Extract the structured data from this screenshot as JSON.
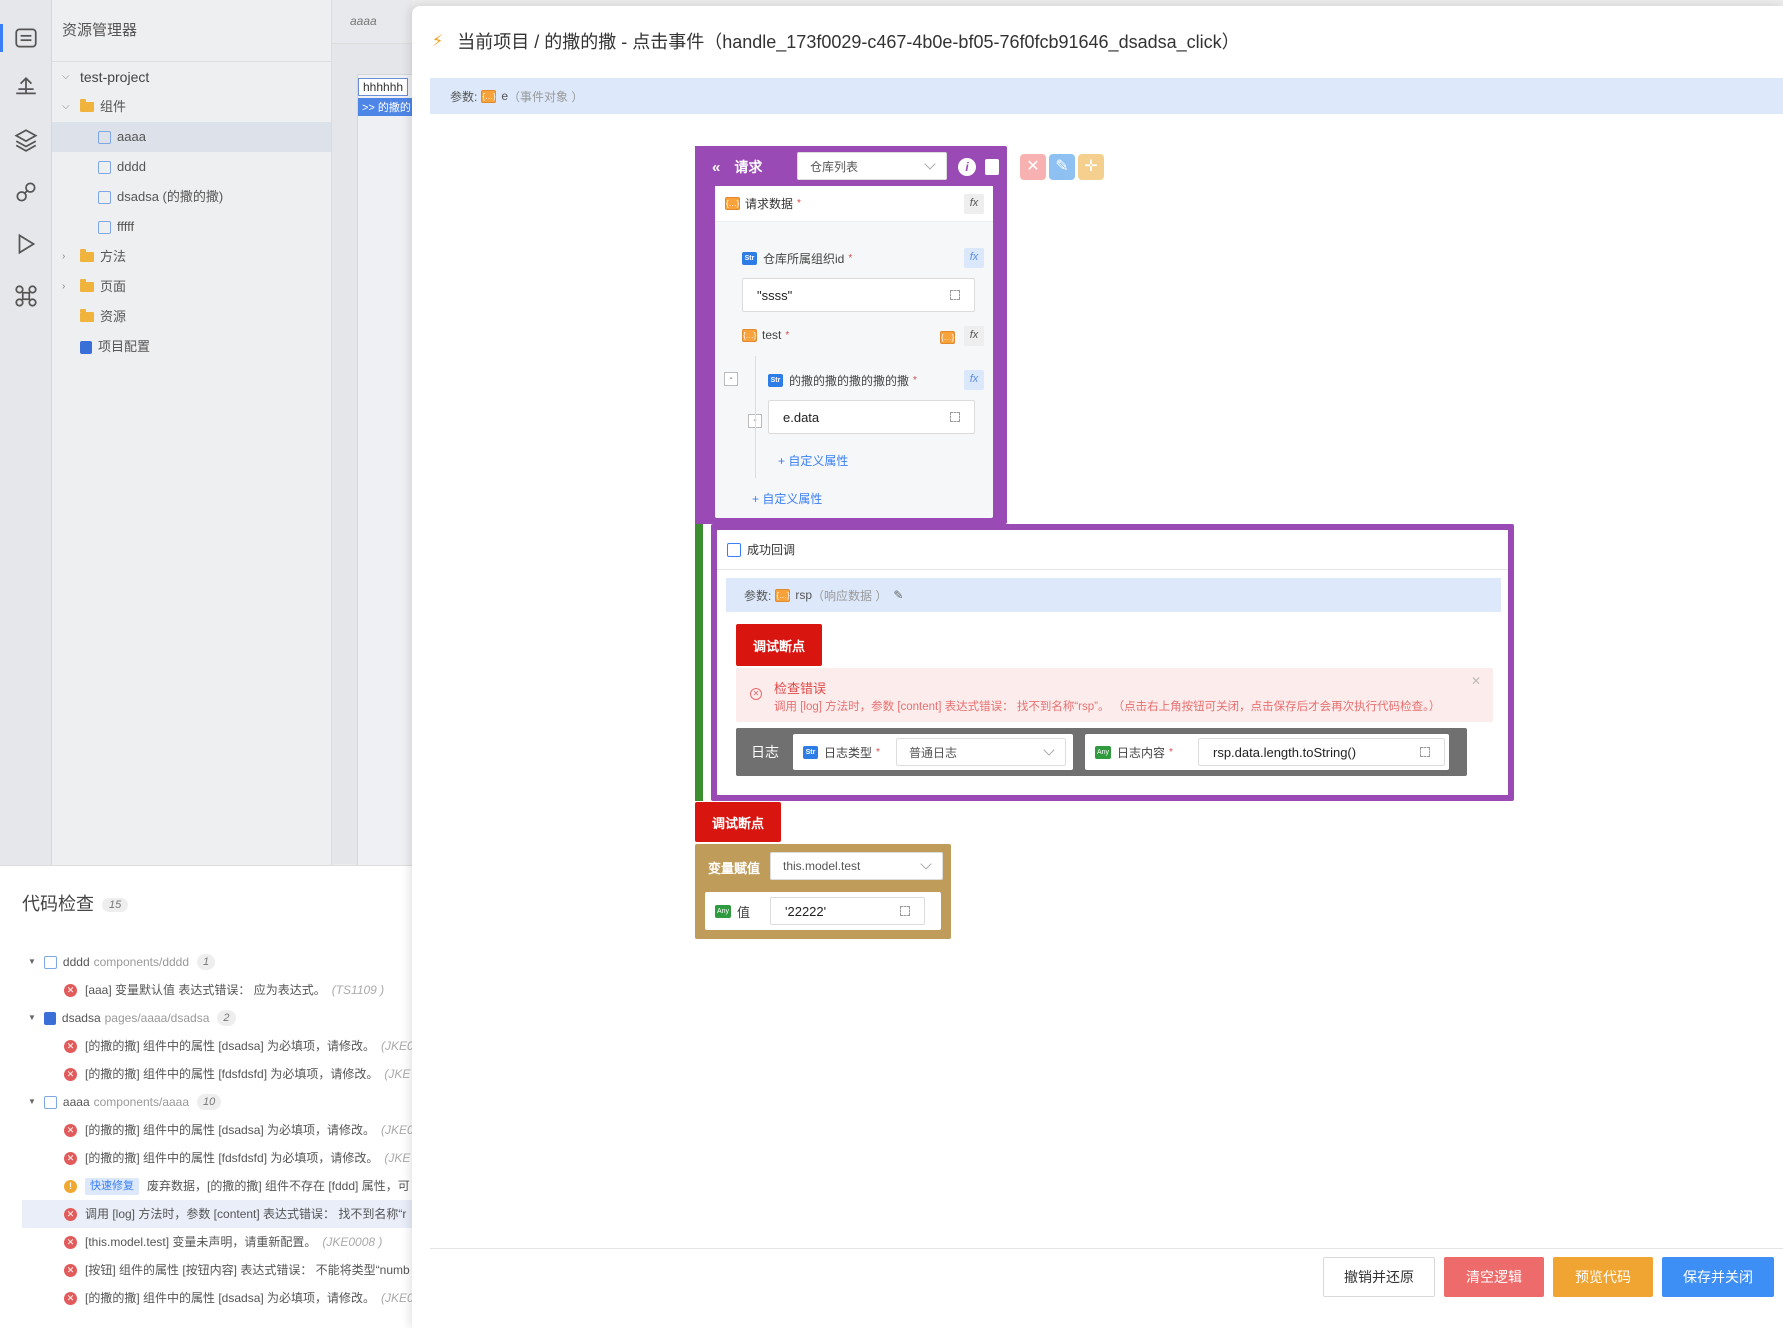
{
  "explorer": {
    "title": "资源管理器",
    "project": "test-project",
    "nodes": {
      "components": "组件",
      "aaaa": "aaaa",
      "dddd": "dddd",
      "dsadsa": "dsadsa (的撒的撒)",
      "fffff": "fffff",
      "methods": "方法",
      "pages": "页面",
      "resources": "资源",
      "project_config": "项目配置"
    }
  },
  "editor": {
    "tab": "aaaa",
    "canvas_text_1": "hhhhhh",
    "canvas_text_2": ">> 的撒的"
  },
  "check": {
    "title": "代码检查",
    "count": "15",
    "groups": [
      {
        "name": "dddd",
        "path": "components/dddd",
        "count": "1"
      },
      {
        "name": "dsadsa",
        "path": "pages/aaaa/dsadsa",
        "count": "2"
      },
      {
        "name": "aaaa",
        "path": "components/aaaa",
        "count": "10"
      }
    ],
    "items": [
      {
        "msg": "[aaa] 变量默认值 表达式错误： 应为表达式。",
        "code": "(TS1109 )"
      },
      {
        "msg": "[的撒的撒] 组件中的属性 [dsadsa] 为必填项，请修改。",
        "code": "(JKE0"
      },
      {
        "msg": "[的撒的撒] 组件中的属性 [fdsfdsfd] 为必填项，请修改。",
        "code": "(JKE"
      },
      {
        "msg": "[的撒的撒] 组件中的属性 [dsadsa] 为必填项，请修改。",
        "code": "(JKE0"
      },
      {
        "msg": "[的撒的撒] 组件中的属性 [fdsfdsfd] 为必填项，请修改。",
        "code": "(JKE"
      },
      {
        "quickfix": "快速修复",
        "msg": "废弃数据，[的撒的撒] 组件不存在 [fddd] 属性，可"
      },
      {
        "msg": "调用 [log] 方法时，参数 [content] 表达式错误： 找不到名称“r"
      },
      {
        "msg": "[this.model.test] 变量未声明，请重新配置。",
        "code": "(JKE0008 )"
      },
      {
        "msg": "[按钮] 组件的属性 [按钮内容] 表达式错误： 不能将类型“numb"
      },
      {
        "msg": "[的撒的撒] 组件中的属性 [dsadsa] 为必填项，请修改。",
        "code": "(JKE0"
      }
    ]
  },
  "modal": {
    "title": "当前项目 / 的撒的撒 - 点击事件（handle_173f0029-c467-4b0e-bf05-76f0fcb91646_dsadsa_click）",
    "param_label": "参数:",
    "param_name": "e",
    "param_desc": "（事件对象 ）",
    "request": {
      "label": "请求",
      "select": "仓库列表",
      "data_label": "请求数据",
      "field1_label": "仓库所属组织id",
      "field1_value": "\"ssss\"",
      "test_label": "test",
      "nested_label": "的撒的撒的撒的撒的撒",
      "nested_value": "e.data",
      "add_prop_inner": "+ 自定义属性",
      "add_prop_outer": "+ 自定义属性"
    },
    "callback": {
      "title": "成功回调",
      "param_label": "参数:",
      "param_name": "rsp",
      "param_desc": "（响应数据 ）",
      "debug": "调试断点",
      "err_title": "检查错误",
      "err_msg": "调用 [log] 方法时，参数 [content] 表达式错误： 找不到名称“rsp”。 （点击右上角按钮可关闭，点击保存后才会再次执行代码检查。）",
      "log_label": "日志",
      "log_type_label": "日志类型",
      "log_type_value": "普通日志",
      "log_content_label": "日志内容",
      "log_content_value": "rsp.data.length.toString()"
    },
    "debug_outer": "调试断点",
    "var": {
      "label": "变量赋值",
      "target": "this.model.test",
      "value_label": "值",
      "value": "'22222'"
    },
    "footer": {
      "revert": "撤销并还原",
      "clear": "清空逻辑",
      "preview": "预览代码",
      "save": "保存并关闭"
    }
  },
  "icons": {
    "str": "Str",
    "any": "Any",
    "obj": "{…}",
    "fx": "fx"
  }
}
